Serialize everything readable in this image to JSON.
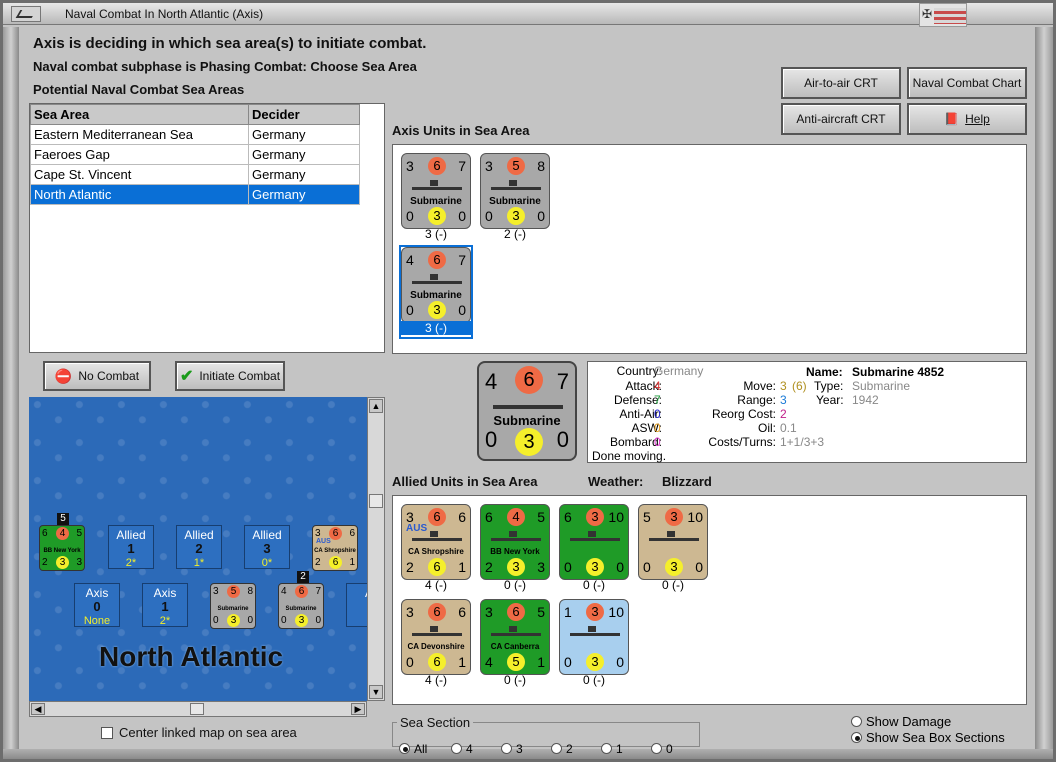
{
  "window": {
    "title": "Naval Combat In North Atlantic (Axis)"
  },
  "header": {
    "line1": "Axis is deciding in which sea area(s) to initiate combat.",
    "line2": "Naval combat subphase is Phasing Combat: Choose Sea Area",
    "line3": "Potential Naval Combat Sea Areas"
  },
  "buttons": {
    "air": "Air-to-air CRT",
    "naval": "Naval Combat Chart",
    "aa": "Anti-aircraft CRT",
    "help": "Help",
    "nocombat": "No Combat",
    "initiate": "Initiate Combat"
  },
  "seatable": {
    "headers": [
      "Sea Area",
      "Decider"
    ],
    "rows": [
      [
        "Eastern Mediterranean Sea",
        "Germany"
      ],
      [
        "Faeroes Gap",
        "Germany"
      ],
      [
        "Cape St. Vincent",
        "Germany"
      ],
      [
        "North Atlantic",
        "Germany"
      ]
    ]
  },
  "axisUnits": {
    "title": "Axis Units in Sea Area",
    "units": [
      {
        "tl": "3",
        "tm": "6",
        "tr": "7",
        "bl": "0",
        "bm": "3",
        "br": "0",
        "name": "Submarine",
        "label": "3 (-)"
      },
      {
        "tl": "3",
        "tm": "5",
        "tr": "8",
        "bl": "0",
        "bm": "3",
        "br": "0",
        "name": "Submarine",
        "label": "2 (-)"
      },
      {
        "tl": "4",
        "tm": "6",
        "tr": "7",
        "bl": "0",
        "bm": "3",
        "br": "0",
        "name": "Submarine",
        "label": "3 (-)"
      }
    ]
  },
  "selected": {
    "tl": "4",
    "tm": "6",
    "tr": "7",
    "bl": "0",
    "bm": "3",
    "br": "0",
    "name": "Submarine"
  },
  "info": {
    "country_l": "Country:",
    "country": "Germany",
    "attack_l": "Attack:",
    "attack": "4",
    "defense_l": "Defense:",
    "defense": "7",
    "aa_l": "Anti-Air:",
    "aa": "0",
    "asw_l": "ASW:",
    "asw": "0",
    "bomb_l": "Bombard:",
    "bomb": "0",
    "move_l": "Move:",
    "move": "3",
    "move_b": "(6)",
    "range_l": "Range:",
    "range": "3",
    "reorg_l": "Reorg Cost:",
    "reorg": "2",
    "oil_l": "Oil:",
    "oil": "0.1",
    "costs_l": "Costs/Turns:",
    "costs": "1+1/3+3",
    "name_l": "Name:",
    "name": "Submarine 4852",
    "type_l": "Type:",
    "type": "Submarine",
    "year_l": "Year:",
    "year": "1942",
    "status": "Done moving."
  },
  "allied": {
    "title": "Allied Units in Sea Area",
    "weather_l": "Weather:",
    "weather": "Blizzard",
    "units": [
      {
        "tl": "3",
        "tm": "6",
        "tr": "6",
        "bl": "2",
        "bm": "6",
        "br": "1",
        "name": "CA Shropshire",
        "tag": "AUS",
        "label": "4 (-)",
        "color": "tan"
      },
      {
        "tl": "6",
        "tm": "4",
        "tr": "5",
        "bl": "2",
        "bm": "3",
        "br": "3",
        "name": "BB New York",
        "label": "0 (-)",
        "color": "green"
      },
      {
        "tl": "6",
        "tm": "3",
        "tr": "10",
        "bl": "0",
        "bm": "3",
        "br": "0",
        "name": "",
        "label": "0 (-)",
        "color": "green"
      },
      {
        "tl": "5",
        "tm": "3",
        "tr": "10",
        "bl": "0",
        "bm": "3",
        "br": "0",
        "name": "",
        "label": "0 (-)",
        "color": "tan"
      },
      {
        "tl": "3",
        "tm": "6",
        "tr": "6",
        "bl": "0",
        "bm": "6",
        "br": "1",
        "name": "CA Devonshire",
        "label": "4 (-)",
        "color": "tan"
      },
      {
        "tl": "3",
        "tm": "6",
        "tr": "5",
        "bl": "4",
        "bm": "5",
        "br": "1",
        "name": "CA Canberra",
        "label": "0 (-)",
        "color": "green"
      },
      {
        "tl": "1",
        "tm": "3",
        "tr": "10",
        "bl": "0",
        "bm": "3",
        "br": "0",
        "name": "",
        "label": "0 (-)",
        "color": "lblue"
      }
    ]
  },
  "map": {
    "title": "North Atlantic",
    "boxes": [
      {
        "side": "Allied",
        "n": "1",
        "s": "2*"
      },
      {
        "side": "Allied",
        "n": "2",
        "s": "1*"
      },
      {
        "side": "Allied",
        "n": "3",
        "s": "0*"
      },
      {
        "side": "Axis",
        "n": "0",
        "s": "None"
      },
      {
        "side": "Axis",
        "n": "1",
        "s": "2*"
      },
      {
        "side": "A"
      }
    ],
    "stack1": "5",
    "stack2": "2",
    "m1": {
      "tl": "6",
      "tm": "4",
      "tr": "5",
      "bl": "2",
      "bm": "3",
      "br": "3",
      "name": "BB New York"
    },
    "m2": {
      "tl": "3",
      "tm": "6",
      "tr": "6",
      "bl": "2",
      "bm": "6",
      "br": "1",
      "name": "CA Shropshire",
      "tag": "AUS"
    },
    "m3": {
      "tl": "3",
      "tm": "5",
      "tr": "8",
      "bl": "0",
      "bm": "3",
      "br": "0",
      "name": "Submarine"
    },
    "m4": {
      "tl": "4",
      "tm": "6",
      "tr": "7",
      "bl": "0",
      "bm": "3",
      "br": "0",
      "name": "Submarine"
    }
  },
  "center_label": "Center linked map on sea area",
  "seasection": {
    "legend": "Sea Section",
    "options": [
      "All",
      "4",
      "3",
      "2",
      "1",
      "0"
    ]
  },
  "show": {
    "damage": "Show Damage",
    "sections": "Show Sea Box Sections"
  }
}
